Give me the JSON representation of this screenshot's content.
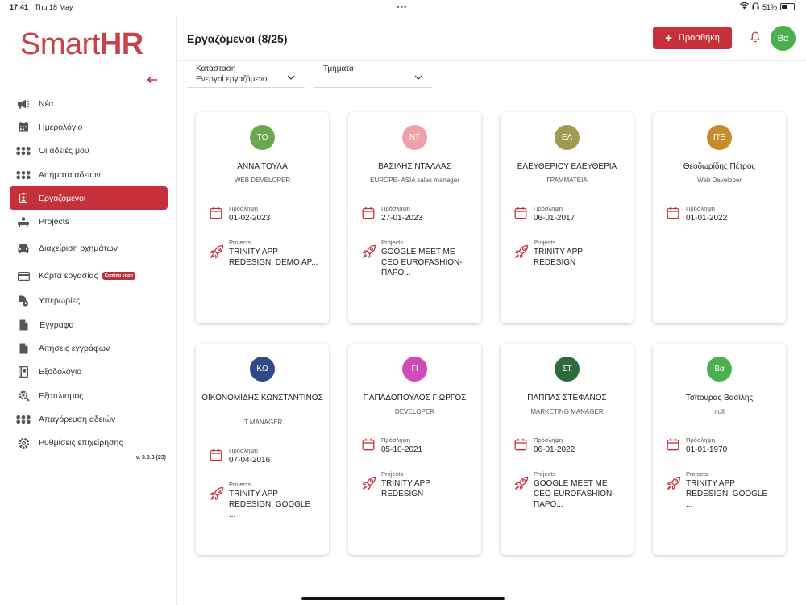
{
  "status_bar": {
    "time": "17:41",
    "date": "Thu 18 May",
    "battery": "51%",
    "battery_level": 0.51
  },
  "app": {
    "logo_smart": "Smart",
    "logo_hr": "HR",
    "version": "v. 3.0.3 (23)"
  },
  "colors": {
    "accent": "#c7303a",
    "logo": "#c7424b"
  },
  "sidebar": {
    "items": [
      {
        "label": "Νέα",
        "icon": "megaphone-icon"
      },
      {
        "label": "Ημερολόγιο",
        "icon": "calendar-icon"
      },
      {
        "label": "Οι άδειές μου",
        "icon": "dots-grid-icon"
      },
      {
        "label": "Αιτήματα αδειών",
        "icon": "dots-grid-icon"
      },
      {
        "label": "Εργαζόμενοι",
        "icon": "badge-icon",
        "active": true
      },
      {
        "label": "Projects",
        "icon": "projects-icon"
      },
      {
        "label": "Διαχείριση οχημάτων",
        "icon": "car-icon"
      },
      {
        "label": "Κάρτα εργασίας",
        "icon": "card-icon",
        "badge": "Coming soon"
      },
      {
        "label": "Υπερωρίες",
        "icon": "file-clock-icon"
      },
      {
        "label": "Έγγραφα",
        "icon": "document-icon"
      },
      {
        "label": "Αιτήσεις εγγράφων",
        "icon": "document-icon"
      },
      {
        "label": "Εξοδολόγιο",
        "icon": "ledger-icon"
      },
      {
        "label": "Εξοπλισμός",
        "icon": "equipment-gear-icon"
      },
      {
        "label": "Απαγόρευση αδειών",
        "icon": "dots-grid-icon"
      },
      {
        "label": "Ρυθμίσεις επιχείρησης",
        "icon": "settings-gear-icon"
      }
    ]
  },
  "header": {
    "title": "Εργαζόμενοι (8/25)",
    "add_label": "Προσθήκη",
    "avatar_initials": "Βα"
  },
  "filters": [
    {
      "label": "Κατάσταση",
      "value": "Ενεργοί εργαζόμενοι"
    },
    {
      "label": "Τμήματα",
      "value": ""
    }
  ],
  "cards": {
    "hire_label": "Πρόσληψη",
    "projects_label": "Projects",
    "items": [
      {
        "initials": "ΤΟ",
        "color": "#6aa84f",
        "name": "ΑΝΝΑ ΤΟΥΛΑ",
        "role": "WEB DEVELOPER",
        "hire_date": "01-02-2023",
        "projects": "TRINITY APP REDESIGN, DEMO AP..."
      },
      {
        "initials": "ΝΤ",
        "color": "#f0a0a8",
        "name": "ΒΑΣΙΛΗΣ ΝΤΑΛΛΑΣ",
        "role": "EUROPE- ASIA sales manager",
        "hire_date": "27-01-2023",
        "projects": "GOOGLE MEET ME CEO EUROFASHION-ΠΑΡΟ..."
      },
      {
        "initials": "ΕΛ",
        "color": "#a09a55",
        "name": "ΕΛΕΥΘΕΡΙΟΥ ΕΛΕΥΘΕΡΙΑ",
        "role": "ΓΡΑΜΜΑΤΕΙΑ",
        "hire_date": "06-01-2017",
        "projects": "TRINITY APP REDESIGN"
      },
      {
        "initials": "ΠΈ",
        "color": "#c98a2b",
        "name": "Θεοδωρίδης Πέτρος",
        "role": "Web Developer",
        "hire_date": "01-01-2022",
        "projects": ""
      },
      {
        "initials": "ΚΩ",
        "color": "#2f4a8a",
        "name": "ΟΙΚΟΝΟΜΙΔΗΣ ΚΩΝΣΤΑΝΤΙΝΟΣ",
        "role": "IT MANAGER",
        "hire_date": "07-04-2016",
        "projects": "TRINITY APP REDESIGN, GOOGLE ..."
      },
      {
        "initials": "ΓΙ",
        "color": "#d04ab8",
        "name": "ΠΑΠΑΔΟΠΟΥΛΟΣ ΓΙΩΡΓΟΣ",
        "role": "DEVELOPER",
        "hire_date": "05-10-2021",
        "projects": "TRINITY APP REDESIGN"
      },
      {
        "initials": "ΣΤ",
        "color": "#2e6b3c",
        "name": "ΠΑΠΠΑΣ ΣΤΕΦΑΝΟΣ",
        "role": "MARKETING MANAGER",
        "hire_date": "06-01-2022",
        "projects": "GOOGLE MEET ME CEO EUROFASHION-ΠΑΡΟ..."
      },
      {
        "initials": "Βα",
        "color": "#4caf50",
        "name": "Τσίτουρας Βασίλης",
        "role": "null",
        "hire_date": "01-01-1970",
        "projects": "TRINITY APP REDESIGN, GOOGLE ..."
      }
    ]
  }
}
